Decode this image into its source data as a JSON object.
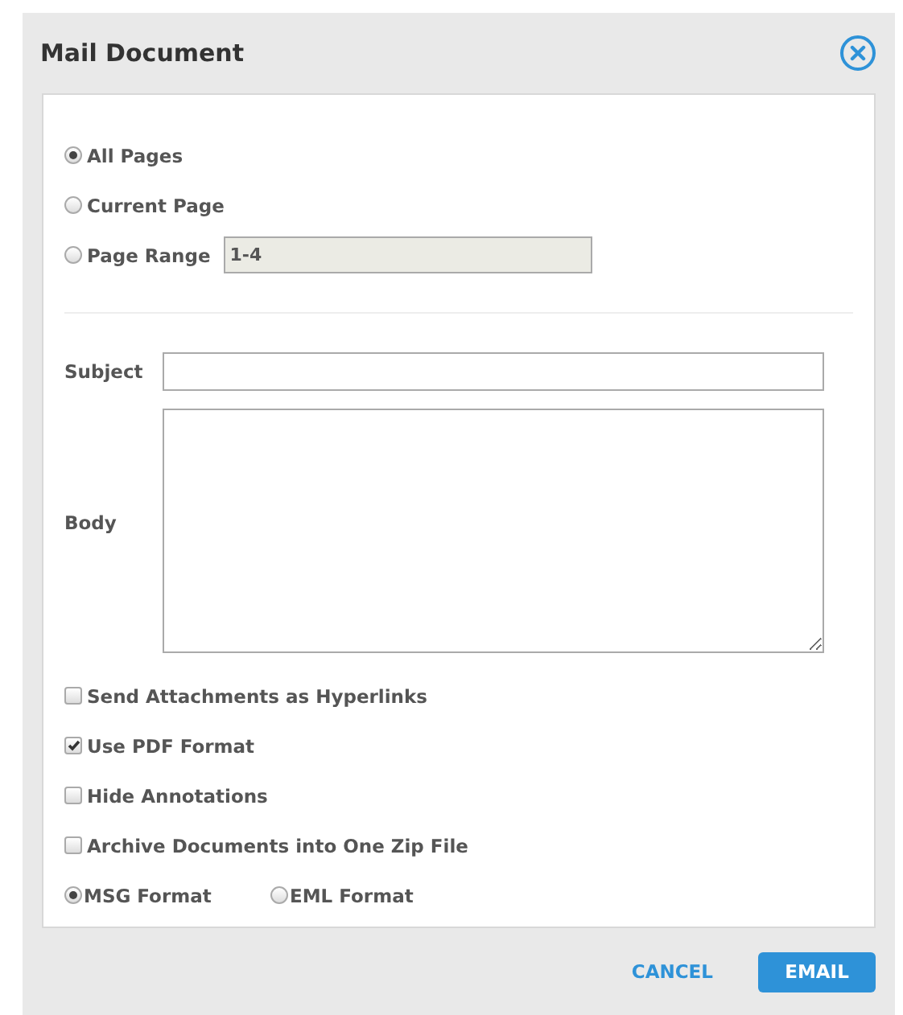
{
  "dialog": {
    "title": "Mail Document"
  },
  "page_options": [
    {
      "label": "All Pages",
      "selected": true
    },
    {
      "label": "Current Page",
      "selected": false
    },
    {
      "label": "Page Range",
      "selected": false,
      "range_value": "1-4"
    }
  ],
  "subject": {
    "label": "Subject"
  },
  "body": {
    "label": "Body"
  },
  "options": [
    {
      "label": "Send Attachments as Hyperlinks",
      "checked": false
    },
    {
      "label": "Use PDF Format",
      "checked": true
    },
    {
      "label": "Hide Annotations",
      "checked": false
    },
    {
      "label": "Archive Documents into One Zip File",
      "checked": false
    }
  ],
  "formats": [
    {
      "label": "MSG Format",
      "selected": true
    },
    {
      "label": "EML Format",
      "selected": false
    }
  ],
  "buttons": {
    "cancel": "CANCEL",
    "email": "EMAIL"
  }
}
